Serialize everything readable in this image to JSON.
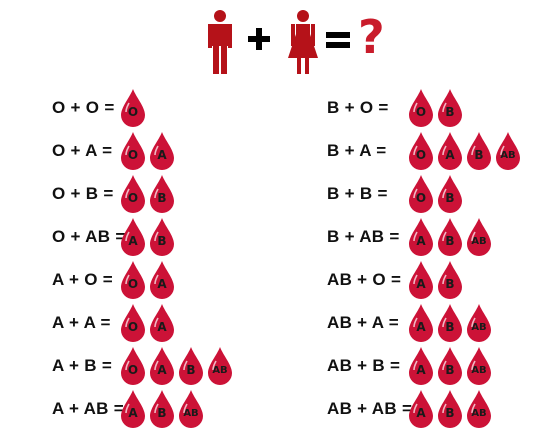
{
  "colors": {
    "blood": "#cc1237",
    "drop_highlight": "#ffffff",
    "figure": "#b51219",
    "plus": "#000000",
    "equals": "#000000",
    "question": "#c91c2b"
  },
  "header": {
    "question": "?"
  },
  "left_column": [
    {
      "label": "O + O =",
      "children": [
        "O"
      ]
    },
    {
      "label": "O + A =",
      "children": [
        "O",
        "A"
      ]
    },
    {
      "label": "O + B =",
      "children": [
        "O",
        "B"
      ]
    },
    {
      "label": "O + AB =",
      "children": [
        "A",
        "B"
      ]
    },
    {
      "label": "A + O =",
      "children": [
        "O",
        "A"
      ]
    },
    {
      "label": "A + A =",
      "children": [
        "O",
        "A"
      ]
    },
    {
      "label": "A + B =",
      "children": [
        "O",
        "A",
        "B",
        "AB"
      ]
    },
    {
      "label": "A + AB =",
      "children": [
        "A",
        "B",
        "AB"
      ]
    }
  ],
  "right_column": [
    {
      "label": "B + O =",
      "children": [
        "O",
        "B"
      ]
    },
    {
      "label": "B + A =",
      "children": [
        "O",
        "A",
        "B",
        "AB"
      ]
    },
    {
      "label": "B + B =",
      "children": [
        "O",
        "B"
      ]
    },
    {
      "label": "B + AB =",
      "children": [
        "A",
        "B",
        "AB"
      ]
    },
    {
      "label": "AB + O =",
      "children": [
        "A",
        "B"
      ]
    },
    {
      "label": "AB + A =",
      "children": [
        "A",
        "B",
        "AB"
      ]
    },
    {
      "label": "AB + B =",
      "children": [
        "A",
        "B",
        "AB"
      ]
    },
    {
      "label": "AB + AB =",
      "children": [
        "A",
        "B",
        "AB"
      ]
    }
  ]
}
